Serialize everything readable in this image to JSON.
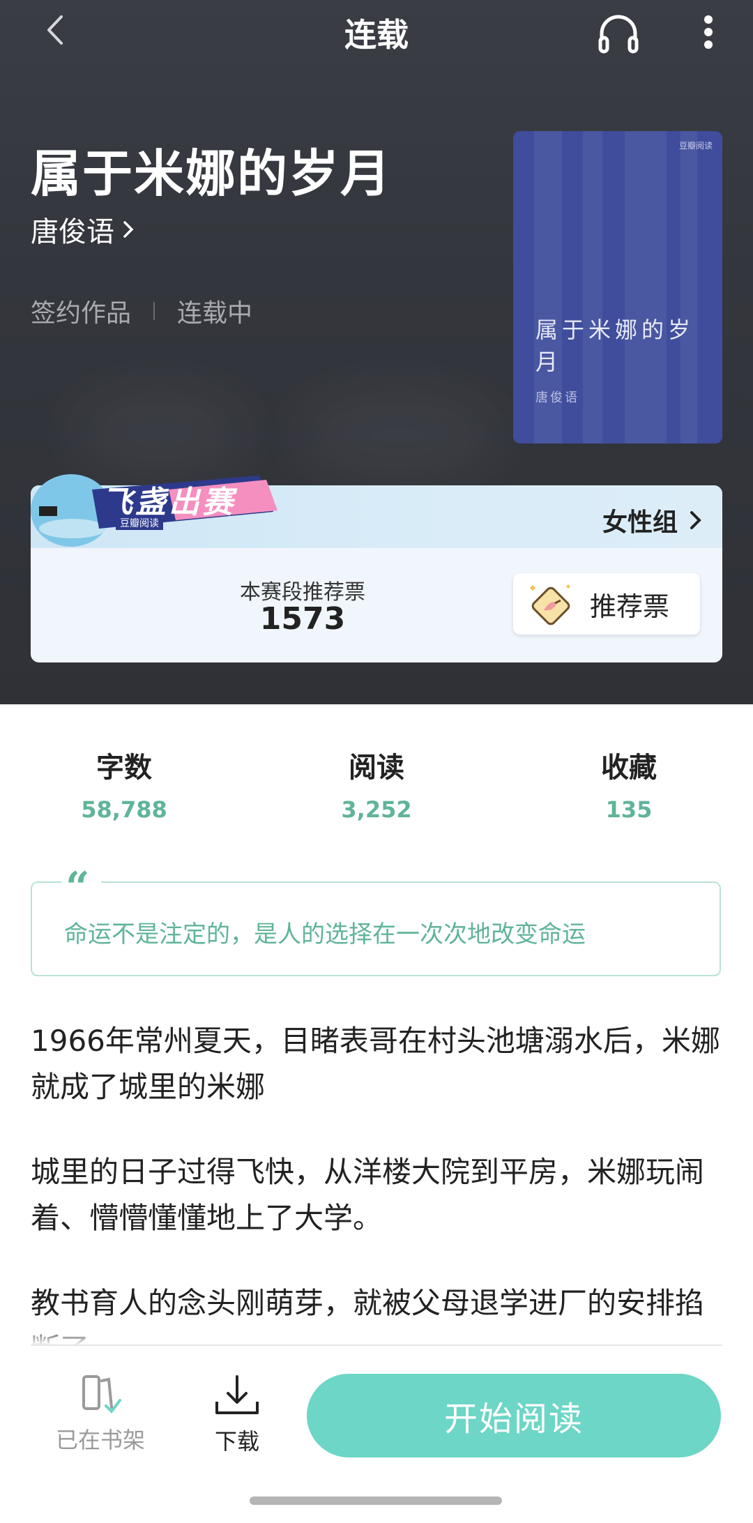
{
  "header": {
    "title": "连载",
    "back_icon": "chevron-left-icon",
    "audio_icon": "headphone-icon",
    "more_icon": "more-vertical-icon"
  },
  "book": {
    "title": "属于米娜的岁月",
    "author": "唐俊语",
    "tags": [
      "签约作品",
      "连载中"
    ],
    "cover_title": "属于米娜的岁月",
    "cover_author": "唐俊语",
    "cover_logo": "豆瓣阅读"
  },
  "contest": {
    "logo_text": "飞盏出赛",
    "logo_sub": "豆瓣阅读",
    "group": "女性组",
    "votes_label": "本赛段推荐票",
    "votes_value": "1573",
    "vote_button": "推荐票"
  },
  "stats": [
    {
      "label": "字数",
      "value": "58,788"
    },
    {
      "label": "阅读",
      "value": "3,252"
    },
    {
      "label": "收藏",
      "value": "135"
    }
  ],
  "quote": {
    "mark": "“",
    "text": "命运不是注定的，是人的选择在一次次地改变命运"
  },
  "intro": [
    "1966年常州夏天，目睹表哥在村头池塘溺水后，米娜就成了城里的米娜",
    "城里的日子过得飞快，从洋楼大院到平房，米娜玩闹着、懵懵懂懂地上了大学。",
    "教书育人的念头刚萌芽，就被父母退学进厂的安排掐断了。"
  ],
  "bottom": {
    "shelf_label": "已在书架",
    "download_label": "下载",
    "read_label": "开始阅读"
  },
  "colors": {
    "accent": "#6dd6c6",
    "accent_text": "#5fb49a",
    "hero_bg": "#34363d",
    "cover_bg": "#3f4d9c"
  }
}
